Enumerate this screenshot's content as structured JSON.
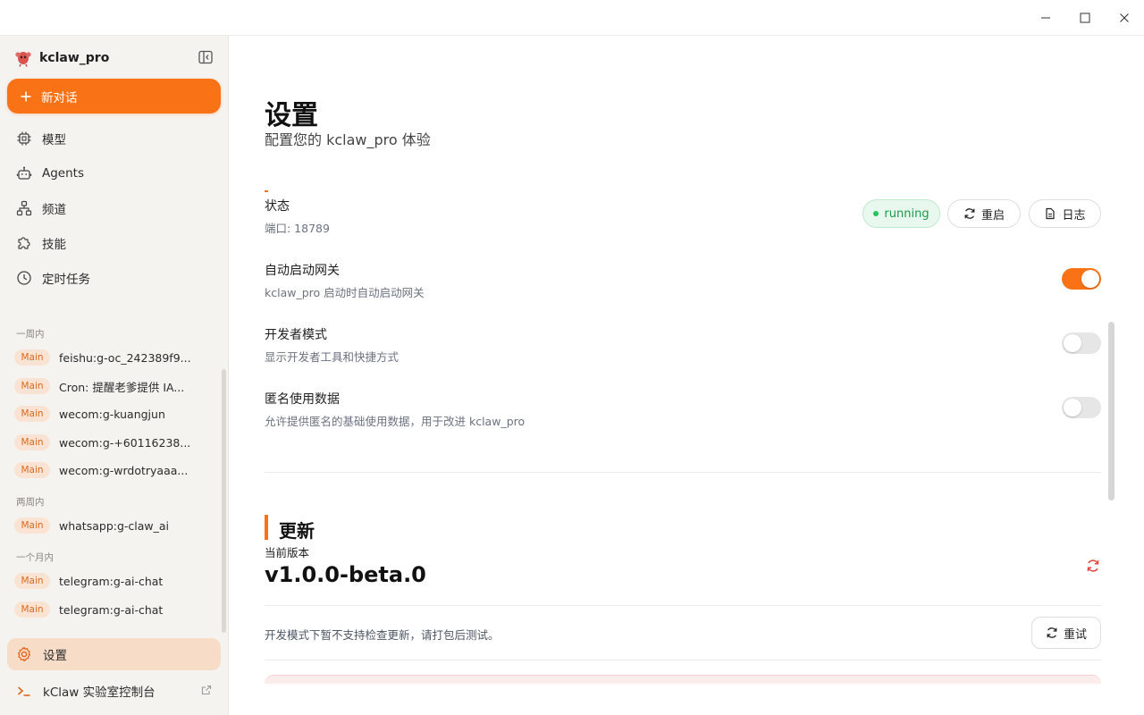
{
  "window": {
    "controls": [
      "minimize",
      "maximize",
      "close"
    ]
  },
  "sidebar": {
    "app_name": "kclaw_pro",
    "new_chat_label": "新对话",
    "nav": [
      {
        "label": "模型",
        "icon": "chip-icon"
      },
      {
        "label": "Agents",
        "icon": "robot-icon"
      },
      {
        "label": "频道",
        "icon": "network-icon"
      },
      {
        "label": "技能",
        "icon": "puzzle-icon"
      },
      {
        "label": "定时任务",
        "icon": "clock-icon"
      }
    ],
    "groups": [
      {
        "label": "一周内",
        "items": [
          {
            "badge": "Main",
            "title": "feishu:g-oc_242389f9..."
          },
          {
            "badge": "Main",
            "title": "Cron: 提醒老爹提供 IA..."
          },
          {
            "badge": "Main",
            "title": "wecom:g-kuangjun"
          },
          {
            "badge": "Main",
            "title": "wecom:g-+60116238..."
          },
          {
            "badge": "Main",
            "title": "wecom:g-wrdotryaaa..."
          }
        ]
      },
      {
        "label": "两周内",
        "items": [
          {
            "badge": "Main",
            "title": "whatsapp:g-claw_ai"
          }
        ]
      },
      {
        "label": "一个月内",
        "items": [
          {
            "badge": "Main",
            "title": "telegram:g-ai-chat"
          },
          {
            "badge": "Main",
            "title": "telegram:g-ai-chat"
          }
        ]
      }
    ],
    "settings_label": "设置",
    "console_label": "kClaw 实验室控制台"
  },
  "main": {
    "title": "设置",
    "subtitle": "配置您的 kclaw_pro 体验",
    "gateway": {
      "status_title": "状态",
      "port_text": "端口: 18789",
      "status_value": "running",
      "restart_label": "重启",
      "logs_label": "日志"
    },
    "toggles": [
      {
        "title": "自动启动网关",
        "desc": "kclaw_pro 启动时自动启动网关",
        "on": true
      },
      {
        "title": "开发者模式",
        "desc": "显示开发者工具和快捷方式",
        "on": false
      },
      {
        "title": "匿名使用数据",
        "desc": "允许提供匿名的基础使用数据，用于改进 kclaw_pro",
        "on": false
      }
    ],
    "update": {
      "section_title": "更新",
      "current_version_label": "当前版本",
      "version": "v1.0.0-beta.0",
      "dev_note": "开发模式下暂不支持检查更新，请打包后测试。",
      "retry_label": "重试"
    }
  },
  "colors": {
    "accent": "#f97316",
    "running": "#1b9a4b",
    "sidebar_bg": "#f5f3f0"
  }
}
